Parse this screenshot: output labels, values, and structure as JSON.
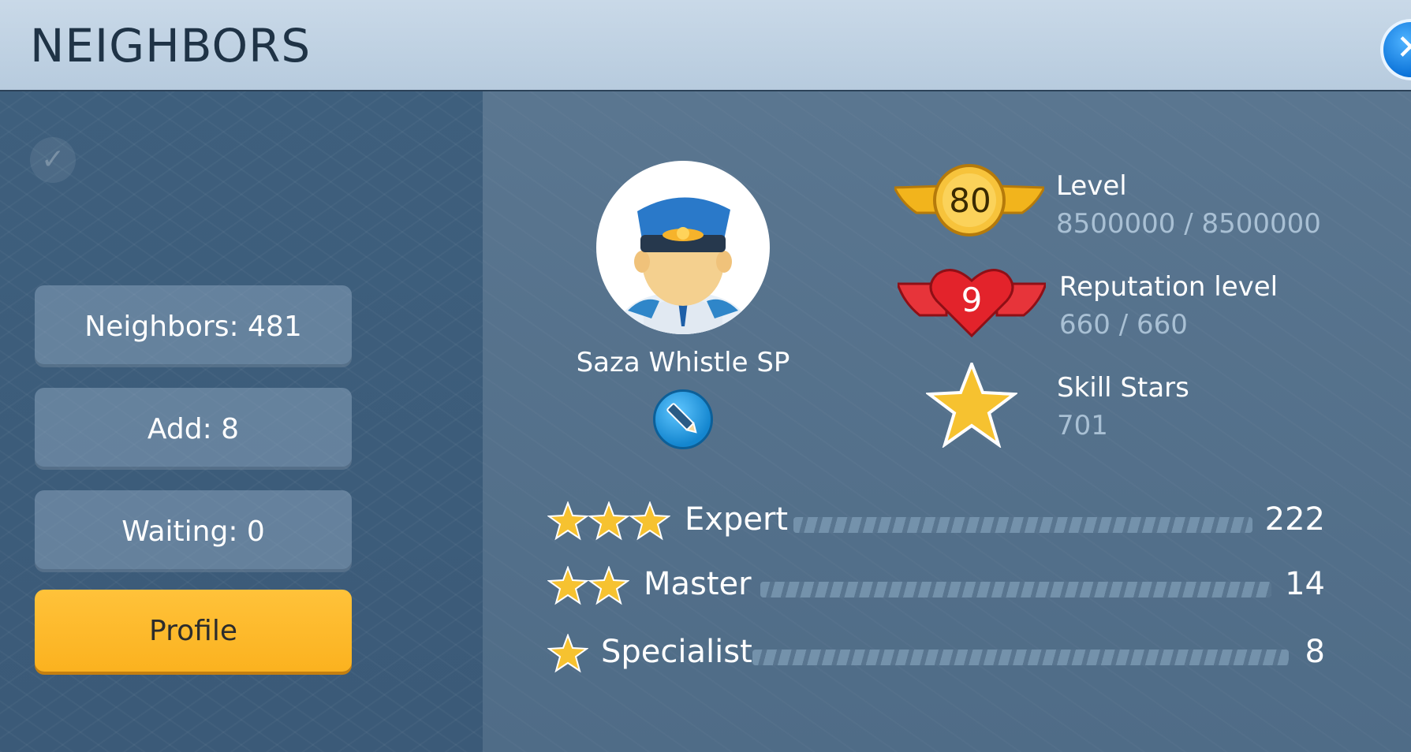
{
  "header": {
    "title": "NEIGHBORS",
    "close_icon": "close-icon"
  },
  "sidebar": {
    "neighbors_label": "Neighbors: 481",
    "add_label": "Add: 8",
    "waiting_label": "Waiting: 0",
    "profile_label": "Profile"
  },
  "player": {
    "name": "Saza Whistle SP",
    "avatar_icon": "police-officer-avatar",
    "edit_icon": "pencil-icon"
  },
  "stats": {
    "level": {
      "badge": "80",
      "label": "Level",
      "value": "8500000 / 8500000"
    },
    "reputation": {
      "badge": "9",
      "label": "Reputation level",
      "value": "660 / 660"
    },
    "skill_stars": {
      "label": "Skill Stars",
      "value": "701"
    }
  },
  "skills": [
    {
      "stars": 3,
      "label": "Expert",
      "count": "222"
    },
    {
      "stars": 2,
      "label": "Master",
      "count": "14"
    },
    {
      "stars": 1,
      "label": "Specialist",
      "count": "8"
    }
  ],
  "colors": {
    "accent": "#fbb21f",
    "header_bg": "#b7cbde",
    "panel_bg": "#4f6c87"
  }
}
